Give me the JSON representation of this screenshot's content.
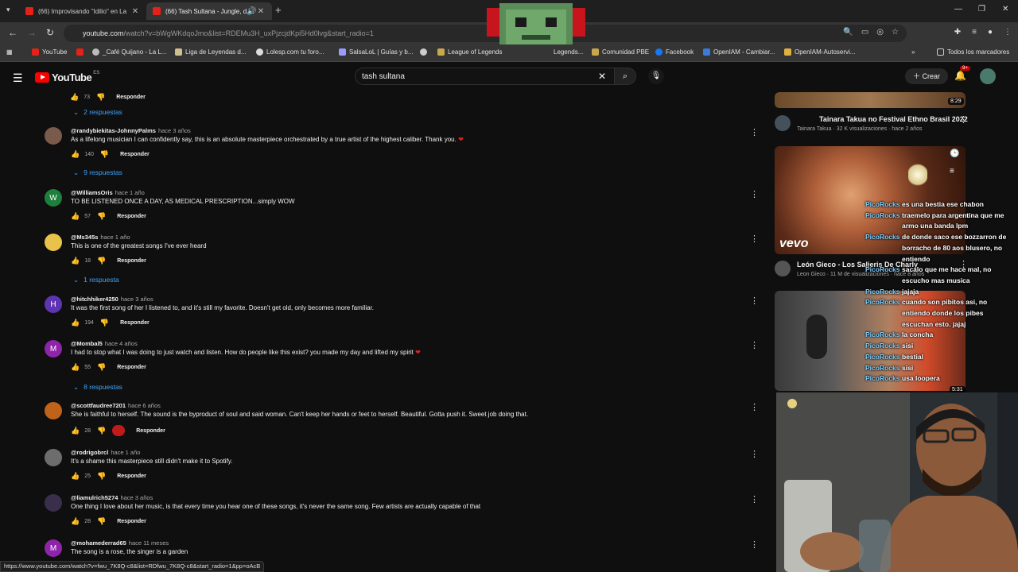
{
  "browser": {
    "tabs": [
      {
        "title": "(66) Improvisando \"Idilio\" en La"
      },
      {
        "title": "(66) Tash Sultana - Jungle, d"
      }
    ],
    "url": "youtube.com/watch?v=bWgWKdqoJmo&list=RDEMu3H_uxPjzcjdKpi5Hd0lvg&start_radio=1",
    "url_host": "youtube.com",
    "url_rest": "/watch?v=bWgWKdqoJmo&list=RDEMu3H_uxPjzcjdKpi5Hd0lvg&start_radio=1",
    "bookmarks": [
      "YouTube",
      "_Café Quijano - La L...",
      "Liga de Leyendas d...",
      "Lolesp.com tu foro...",
      "SalsaLoL | Guías y b...",
      "",
      "League of Legends",
      "Legends...",
      "Comunidad PBE",
      "Facebook",
      "OpenIAM - Cambiar...",
      "OpenIAM-Autoservi..."
    ],
    "all_bookmarks": "Todos los marcadores",
    "status_url": "https://www.youtube.com/watch?v=fwu_7K8Q-c8&list=RDfwu_7K8Q-c8&start_radio=1&pp=oAcB"
  },
  "youtube": {
    "logo_text": "YouTube",
    "region": "ES",
    "search_query": "tash sultana",
    "create_label": "Crear",
    "notif_count": "9+"
  },
  "top_actions": {
    "likes": "73",
    "reply": "Responder"
  },
  "top_replies": "2 respuestas",
  "comments": [
    {
      "user": "@randybiekitas-JohnnyPalms",
      "time": "hace 3 años",
      "text": "As a lifelong musician I can confidently say, this is an absolute masterpiece orchestrated by a true artist of the highest caliber. Thank you.",
      "likes": "140",
      "reply": "Responder",
      "replies": "9 respuestas",
      "avatar": "",
      "avatar_color": "#7a5a4a",
      "heart": "❤"
    },
    {
      "user": "@WilliamsOris",
      "time": "hace 1 año",
      "text": "TO BE LISTENED ONCE A DAY, AS MEDICAL PRESCRIPTION...simply WOW",
      "likes": "57",
      "reply": "Responder",
      "replies": "",
      "avatar": "W",
      "avatar_color": "#1e7f3c",
      "heart": ""
    },
    {
      "user": "@Ms345s",
      "time": "hace 1 año",
      "text": "This is one of the greatest songs I've ever heard",
      "likes": "18",
      "reply": "Responder",
      "replies": "1 respuesta",
      "avatar": "",
      "avatar_color": "#e8c24a",
      "heart": ""
    },
    {
      "user": "@hitchhiker4250",
      "time": "hace 3 años",
      "text": "It was the first song of her I listened to, and it's still my favorite. Doesn't get old, only becomes more familiar.",
      "likes": "194",
      "reply": "Responder",
      "replies": "",
      "avatar": "H",
      "avatar_color": "#5e35b1",
      "heart": ""
    },
    {
      "user": "@Mombal5",
      "time": "hace 4 años",
      "text": "I had to stop what I was doing to just watch and listen. How do people like this exist?  you made my day and lifted my spirit",
      "likes": "55",
      "reply": "Responder",
      "replies": "8 respuestas",
      "avatar": "M",
      "avatar_color": "#8e24aa",
      "heart": "❤"
    },
    {
      "user": "@scottfaudree7201",
      "time": "hace 6 años",
      "text": "She is faithful to herself. The sound is the byproduct of soul and said woman. Can't keep her hands or feet to herself. Beautiful. Gotta push it. Sweet job doing that.",
      "likes": "28",
      "reply": "Responder",
      "replies": "",
      "avatar": "",
      "avatar_color": "#c0631a",
      "heart": ""
    },
    {
      "user": "@rodrigobrcl",
      "time": "hace 1 año",
      "text": "It's a shame this masterpiece still didn't make it to Spotify.",
      "likes": "25",
      "reply": "Responder",
      "replies": "",
      "avatar": "",
      "avatar_color": "#6d6d6d",
      "heart": ""
    },
    {
      "user": "@liamulrich5274",
      "time": "hace 3 años",
      "text": "One thing I love about her music, is that every time you hear one of these songs, it's never the same song. Few artists are actually capable of that",
      "likes": "28",
      "reply": "Responder",
      "replies": "",
      "avatar": "",
      "avatar_color": "#3a2f4a",
      "heart": ""
    },
    {
      "user": "@mohamederrad65",
      "time": "hace 11 meses",
      "text": "The song is a rose, the singer is a garden",
      "likes": "",
      "reply": "",
      "replies": "",
      "avatar": "M",
      "avatar_color": "#8e24aa",
      "heart": ""
    }
  ],
  "sidebar": {
    "videos": [
      {
        "title": "Tainara Takua no Festival Ethno Brasil 2022",
        "channel": "Tainara Takua",
        "stats": "32 K visualizaciones · hace 2 años",
        "duration": "8:29"
      },
      {
        "title": "León Gieco - Los Salieris De Charly",
        "channel": "Leon Gieco",
        "stats": "11 M de visualizaciones · hace 8 años",
        "duration": ""
      },
      {
        "title": "",
        "channel": "",
        "stats": "",
        "duration": "5:31"
      }
    ],
    "vevo": "vevo"
  },
  "chat": [
    {
      "user": "PicoRocks",
      "msg": "es una bestia ese chabon"
    },
    {
      "user": "PicoRocks",
      "msg": "traemelo para argentina que me"
    },
    {
      "user": "",
      "msg": "armo una banda lpm"
    },
    {
      "user": "PicoRocks",
      "msg": "de donde saco ese bozzarron de"
    },
    {
      "user": "",
      "msg": "borracho de 80 aos blusero, no"
    },
    {
      "user": "",
      "msg": "entiendo"
    },
    {
      "user": "PicoRocks",
      "msg": "sacalo que me hace mal, no"
    },
    {
      "user": "",
      "msg": "escucho mas musica"
    },
    {
      "user": "PicoRocks",
      "msg": "jajaja"
    },
    {
      "user": "PicoRocks",
      "msg": "cuando son pibitos asi, no"
    },
    {
      "user": "",
      "msg": "entiendo donde los pibes"
    },
    {
      "user": "",
      "msg": "escuchan esto. jajaj"
    },
    {
      "user": "PicoRocks",
      "msg": "la concha"
    },
    {
      "user": "PicoRocks",
      "msg": "sisi"
    },
    {
      "user": "PicoRocks",
      "msg": "bestial"
    },
    {
      "user": "PicoRocks",
      "msg": "sisi"
    },
    {
      "user": "PicoRocks",
      "msg": "usa loopera"
    }
  ],
  "colors": {
    "bg": "#0f0f0f",
    "link": "#3ea6ff",
    "heart": "#e02020",
    "chat_user": "#7fd0ff"
  }
}
